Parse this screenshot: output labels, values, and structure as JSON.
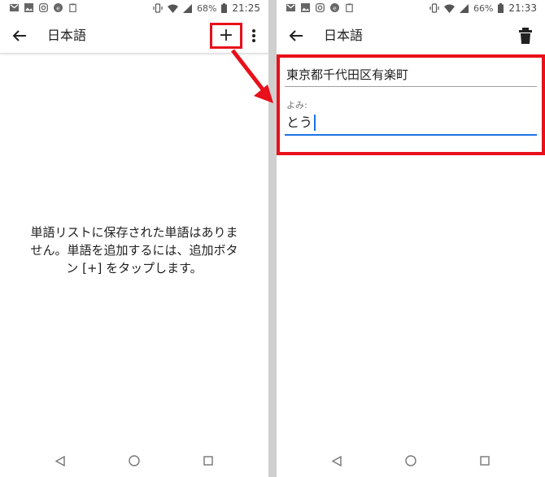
{
  "left_screen": {
    "status": {
      "battery": "68%",
      "time": "21:25"
    },
    "appbar": {
      "title": "日本語",
      "add_label": "+"
    },
    "empty_message": {
      "line1": "単語リストに保存された単語はありま",
      "line2": "せん。単語を追加するには、追加ボタ",
      "line3": "ン [+] をタップします。"
    }
  },
  "right_screen": {
    "status": {
      "battery": "66%",
      "time": "21:33"
    },
    "appbar": {
      "title": "日本語"
    },
    "form": {
      "word_value": "東京都千代田区有楽町",
      "reading_label": "よみ:",
      "reading_value": "とう"
    }
  },
  "icons": [
    "gmail-icon",
    "photo-icon",
    "instagram-icon",
    "edge-icon",
    "clipboard-icon",
    "vibrate-icon",
    "wifi-icon",
    "signal-icon",
    "battery-icon",
    "back-arrow-icon",
    "plus-icon",
    "more-vert-icon",
    "trash-icon",
    "nav-back-icon",
    "nav-home-icon",
    "nav-recents-icon"
  ],
  "colors": {
    "annotation": "#e8101a",
    "focus": "#1a73e8"
  }
}
